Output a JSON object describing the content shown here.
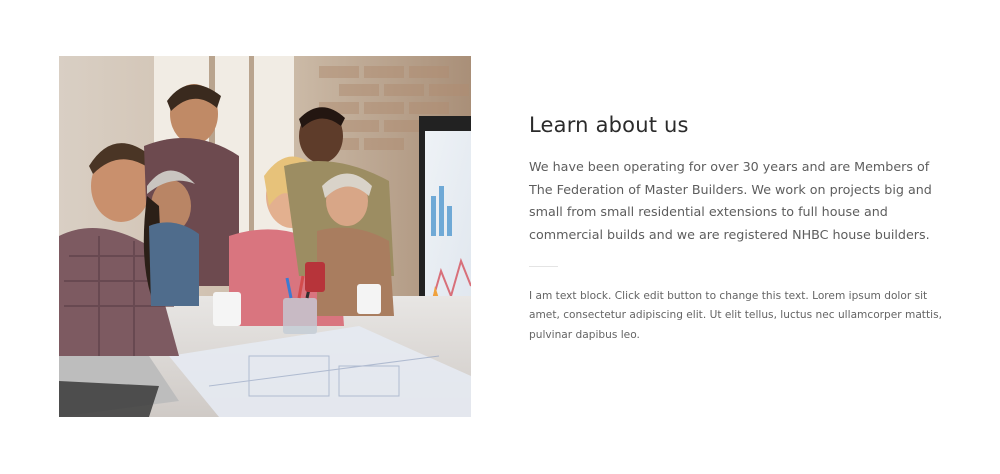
{
  "about": {
    "heading": "Learn about us",
    "lead": "We have been operating for over 30 years and are Members of The Federation of Master Builders. We work on projects big and small from small residential extensions to full house and commercial builds and we are registered NHBC house builders.",
    "body": "I am text block. Click edit button to change this text. Lorem ipsum dolor sit amet, consectetur adipiscing elit. Ut elit tellus, luctus nec ullamcorper mattis, pulvinar dapibus leo."
  },
  "colors": {
    "heading": "#2b2b2b",
    "lead_text": "#5d5d5d",
    "body_text": "#646464",
    "divider": "#e4e4e4"
  }
}
